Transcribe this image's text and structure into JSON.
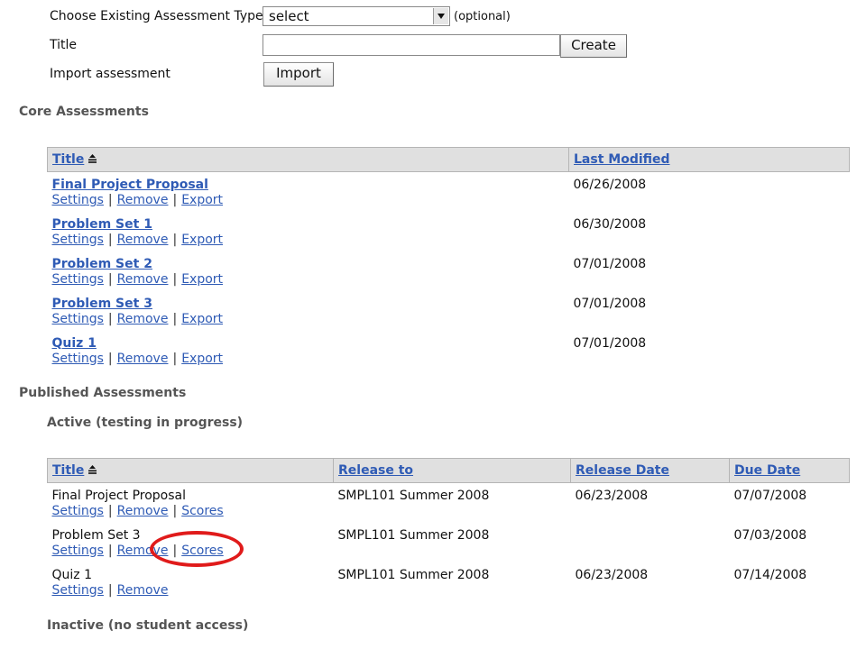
{
  "form": {
    "type_label": "Choose Existing Assessment Type",
    "type_selected": "select",
    "type_hint": "(optional)",
    "title_label": "Title",
    "title_value": "",
    "create_label": "Create",
    "import_label": "Import assessment",
    "import_button": "Import"
  },
  "core": {
    "heading": "Core Assessments",
    "columns": [
      "Title",
      "Last Modified"
    ],
    "rows": [
      {
        "title": "Final Project Proposal",
        "modified": "06/26/2008"
      },
      {
        "title": "Problem Set 1",
        "modified": "06/30/2008"
      },
      {
        "title": "Problem Set 2",
        "modified": "07/01/2008"
      },
      {
        "title": "Problem Set 3",
        "modified": "07/01/2008"
      },
      {
        "title": "Quiz 1",
        "modified": "07/01/2008"
      }
    ],
    "actions": [
      "Settings",
      "Remove",
      "Export"
    ]
  },
  "published": {
    "heading": "Published Assessments",
    "active_heading": "Active (testing in progress)",
    "columns": [
      "Title",
      "Release to",
      "Release Date",
      "Due Date"
    ],
    "rows": [
      {
        "title": "Final Project Proposal",
        "release_to": "SMPL101 Summer 2008",
        "release_date": "06/23/2008",
        "due_date": "07/07/2008",
        "actions": [
          "Settings",
          "Remove",
          "Scores"
        ]
      },
      {
        "title": "Problem Set 3",
        "release_to": "SMPL101 Summer 2008",
        "release_date": "",
        "due_date": "07/03/2008",
        "actions": [
          "Settings",
          "Remove",
          "Scores"
        ]
      },
      {
        "title": "Quiz 1",
        "release_to": "SMPL101 Summer 2008",
        "release_date": "06/23/2008",
        "due_date": "07/14/2008",
        "actions": [
          "Settings",
          "Remove"
        ]
      }
    ],
    "inactive_heading": "Inactive (no student access)"
  },
  "colors": {
    "link": "#2f5bb5",
    "header_bg": "#e0e0e0",
    "annotation": "#e01b1b"
  },
  "icons": {
    "sort": "sort-ascending-icon",
    "dropdown": "chevron-down-icon"
  }
}
